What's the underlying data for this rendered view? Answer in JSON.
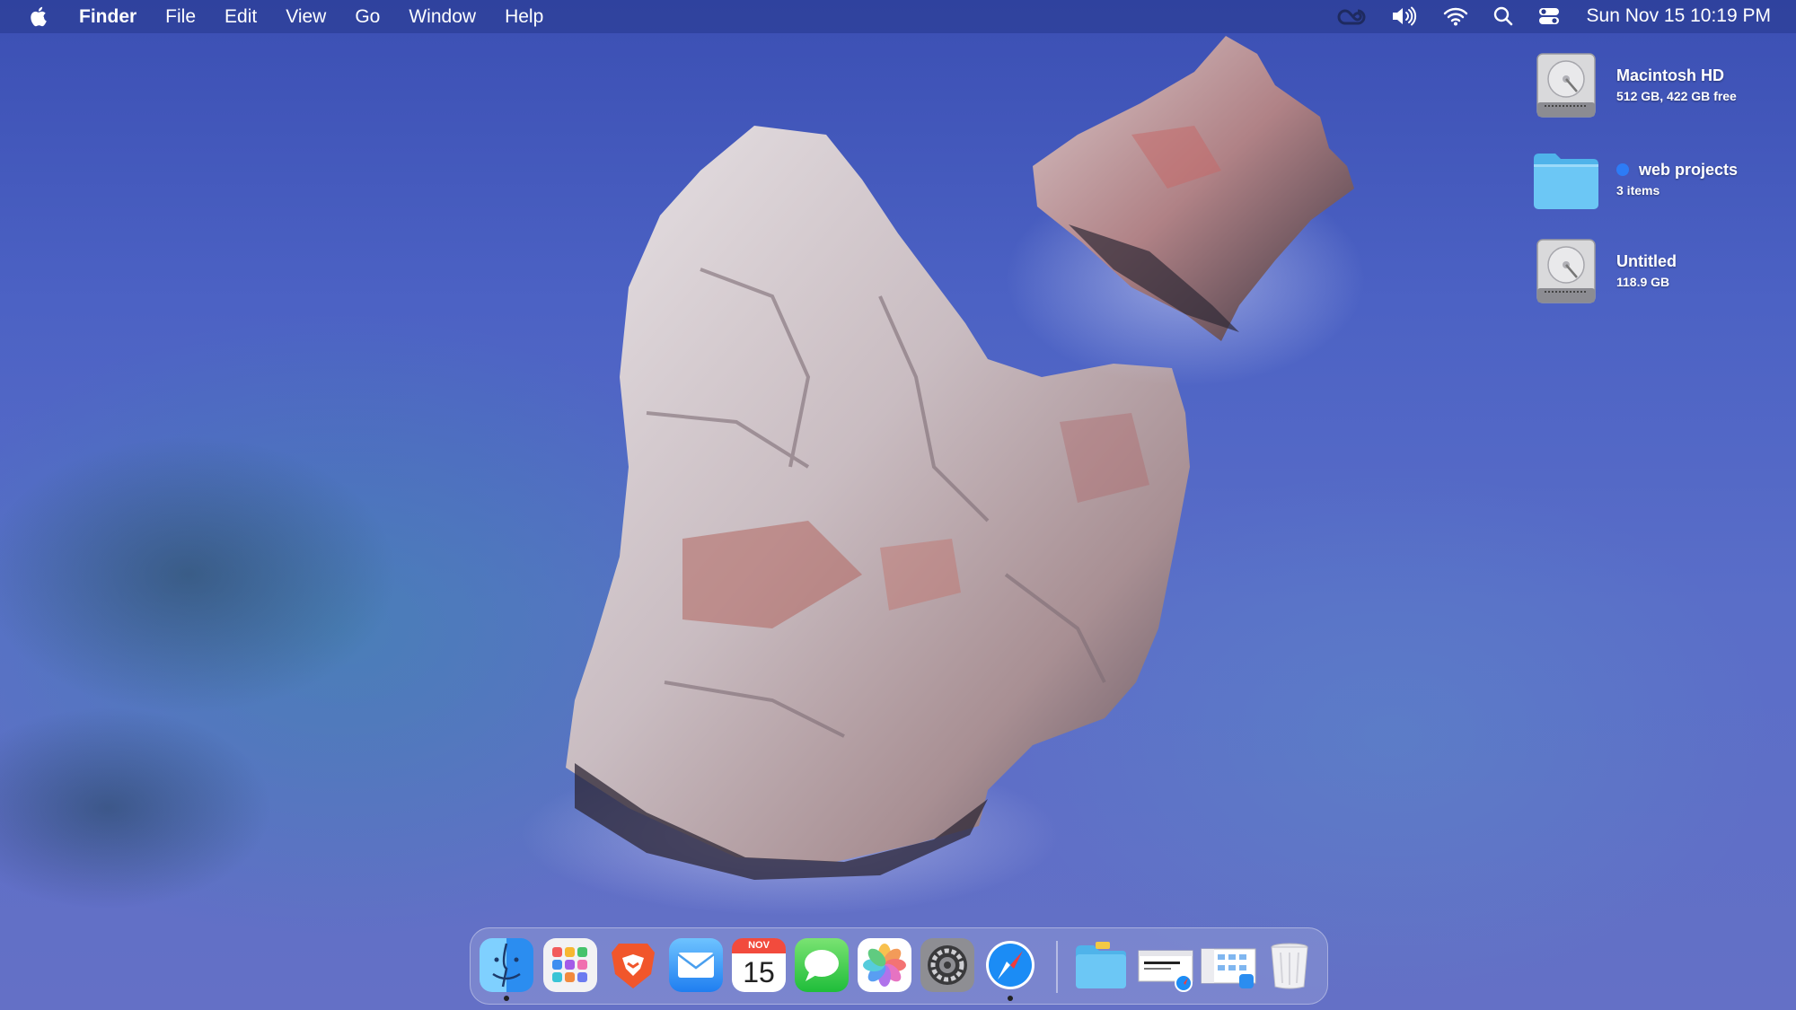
{
  "menubar": {
    "app_name": "Finder",
    "menus": [
      "File",
      "Edit",
      "View",
      "Go",
      "Window",
      "Help"
    ],
    "clock": "Sun Nov 15  10:19 PM"
  },
  "desktop": {
    "items": [
      {
        "name": "Macintosh HD",
        "subtitle": "512 GB, 422 GB free",
        "icon": "hard-drive-icon"
      },
      {
        "name": "web projects",
        "subtitle": "3 items",
        "icon": "folder-icon",
        "tag_color": "#2d7cf6"
      },
      {
        "name": "Untitled",
        "subtitle": "118.9 GB",
        "icon": "hard-drive-icon"
      }
    ]
  },
  "dock": {
    "apps": [
      {
        "name": "Finder",
        "running": true
      },
      {
        "name": "Launchpad",
        "running": false
      },
      {
        "name": "Brave Browser",
        "running": false
      },
      {
        "name": "Mail",
        "running": false
      },
      {
        "name": "Calendar",
        "running": false,
        "month": "NOV",
        "day": "15"
      },
      {
        "name": "Messages",
        "running": false
      },
      {
        "name": "Photos",
        "running": false
      },
      {
        "name": "System Preferences",
        "running": false
      },
      {
        "name": "Safari",
        "running": true
      }
    ],
    "others": [
      {
        "name": "Downloads folder"
      },
      {
        "name": "Safari window"
      },
      {
        "name": "Finder window"
      },
      {
        "name": "Trash"
      }
    ]
  },
  "colors": {
    "menubar": "#26388c",
    "accent": "#2d7cf6",
    "calendar_red": "#f24b3d"
  }
}
